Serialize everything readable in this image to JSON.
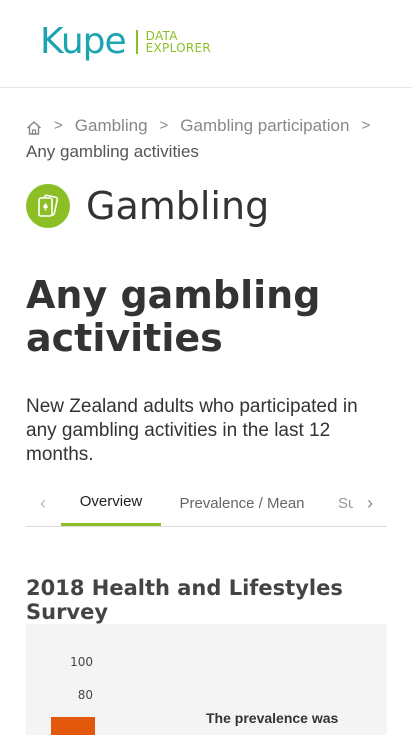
{
  "header": {
    "logo_word": "Kupe",
    "logo_sub_line1": "DATA",
    "logo_sub_line2": "EXPLORER",
    "brand_color": "#1aa5b0",
    "accent_color": "#8cbf26"
  },
  "breadcrumb": {
    "home_icon": "home-icon",
    "items": [
      "Gambling",
      "Gambling participation"
    ],
    "current": "Any gambling activities"
  },
  "topic": {
    "icon": "playing-cards-icon",
    "title": "Gambling"
  },
  "page": {
    "title": "Any gambling activities",
    "description": "New Zealand adults who participated in any gambling activities in the last 12 months."
  },
  "tabs": {
    "items": [
      "Overview",
      "Prevalence / Mean",
      "Su"
    ],
    "active": "Overview"
  },
  "section": {
    "title": "2018 Health and Lifestyles Survey"
  },
  "chart_data": {
    "type": "bar",
    "ytick_labels": [
      "100",
      "80"
    ],
    "ylim": [
      0,
      100
    ],
    "series_color": "#e2580c",
    "annotation": "The prevalence was"
  }
}
